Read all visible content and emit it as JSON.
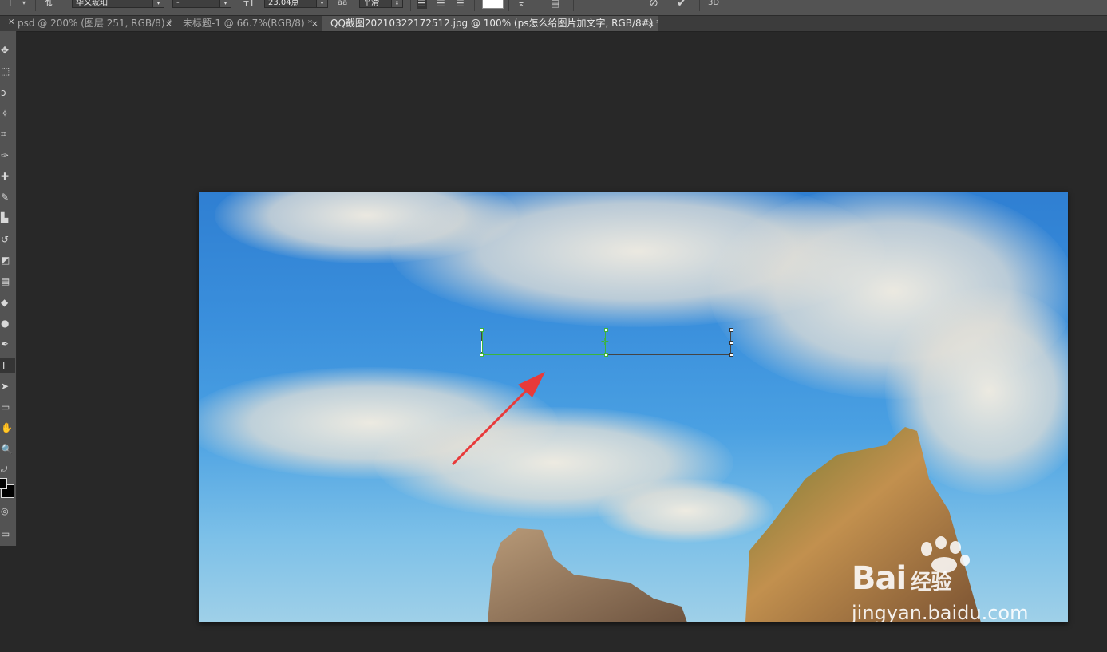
{
  "options_bar": {
    "tool_glyph": "T",
    "font_family": "华文琥珀",
    "font_style": "-",
    "font_size": "23.04点",
    "aa_glyph": "aa",
    "antialias": "平滑",
    "text_color": "#ffffff",
    "threed_label": "3D"
  },
  "tabs": [
    {
      "label": "psd @ 200% (图层 251, RGB/8) *",
      "active": false
    },
    {
      "label": "未标题-1 @ 66.7%(RGB/8) *",
      "active": false
    },
    {
      "label": "QQ截图20210322172512.jpg @ 100% (ps怎么给图片加文字, RGB/8#) *",
      "active": true
    }
  ],
  "tab_close_glyph": "×",
  "tools": [
    {
      "name": "move-tool",
      "glyph": "✥"
    },
    {
      "name": "marquee-tool",
      "glyph": "⬚"
    },
    {
      "name": "lasso-tool",
      "glyph": "ↄ"
    },
    {
      "name": "magic-wand-tool",
      "glyph": "✧"
    },
    {
      "name": "crop-tool",
      "glyph": "⌗"
    },
    {
      "name": "eyedropper-tool",
      "glyph": "✑"
    },
    {
      "name": "healing-brush-tool",
      "glyph": "✚"
    },
    {
      "name": "brush-tool",
      "glyph": "✎"
    },
    {
      "name": "clone-stamp-tool",
      "glyph": "▙"
    },
    {
      "name": "history-brush-tool",
      "glyph": "↺"
    },
    {
      "name": "eraser-tool",
      "glyph": "◩"
    },
    {
      "name": "gradient-tool",
      "glyph": "▤"
    },
    {
      "name": "blur-tool",
      "glyph": "◆"
    },
    {
      "name": "dodge-tool",
      "glyph": "●"
    },
    {
      "name": "pen-tool",
      "glyph": "✒"
    },
    {
      "name": "type-tool",
      "glyph": "T"
    },
    {
      "name": "path-selection-tool",
      "glyph": "➤"
    },
    {
      "name": "shape-tool",
      "glyph": "▭"
    },
    {
      "name": "hand-tool",
      "glyph": "✋"
    },
    {
      "name": "zoom-tool",
      "glyph": "🔍"
    }
  ],
  "selected_tool": "type-tool",
  "colors": {
    "foreground": "#000000",
    "background": "#000000",
    "accent_arrow": "#e83a3a",
    "handle_green": "#3cb43c"
  },
  "watermark": {
    "brand": "Bai",
    "brand_suffix": "经验",
    "url": "jingyan.baidu.com"
  }
}
